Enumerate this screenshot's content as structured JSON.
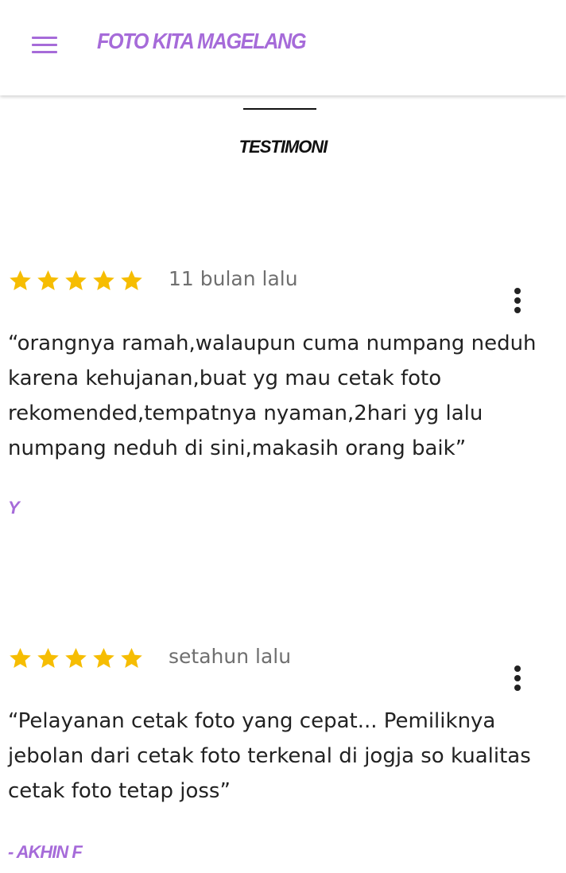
{
  "header": {
    "brand": "FOTO KITA MAGELANG",
    "menu_icon": "hamburger-menu-icon",
    "accent_color": "#a66bd9"
  },
  "section": {
    "title": "TESTIMONI"
  },
  "reviews": [
    {
      "rating": 5,
      "rating_max": 5,
      "time": "11 bulan lalu",
      "text": "“orangnya ramah,walaupun cuma numpang neduh karena kehujanan,buat yg mau cetak foto rekomended,tempatnya nyaman,2hari yg lalu numpang neduh di sini,makasih orang baik”",
      "author": "Y"
    },
    {
      "rating": 5,
      "rating_max": 5,
      "time": "setahun lalu",
      "text": "“Pelayanan cetak foto yang cepat... Pemiliknya jebolan dari cetak foto terkenal di jogja so kualitas cetak foto tetap joss”",
      "author": "- AKHIN F"
    }
  ],
  "colors": {
    "star": "#f6bd02",
    "muted_text": "#6f6f6f",
    "body_text": "#222222"
  }
}
